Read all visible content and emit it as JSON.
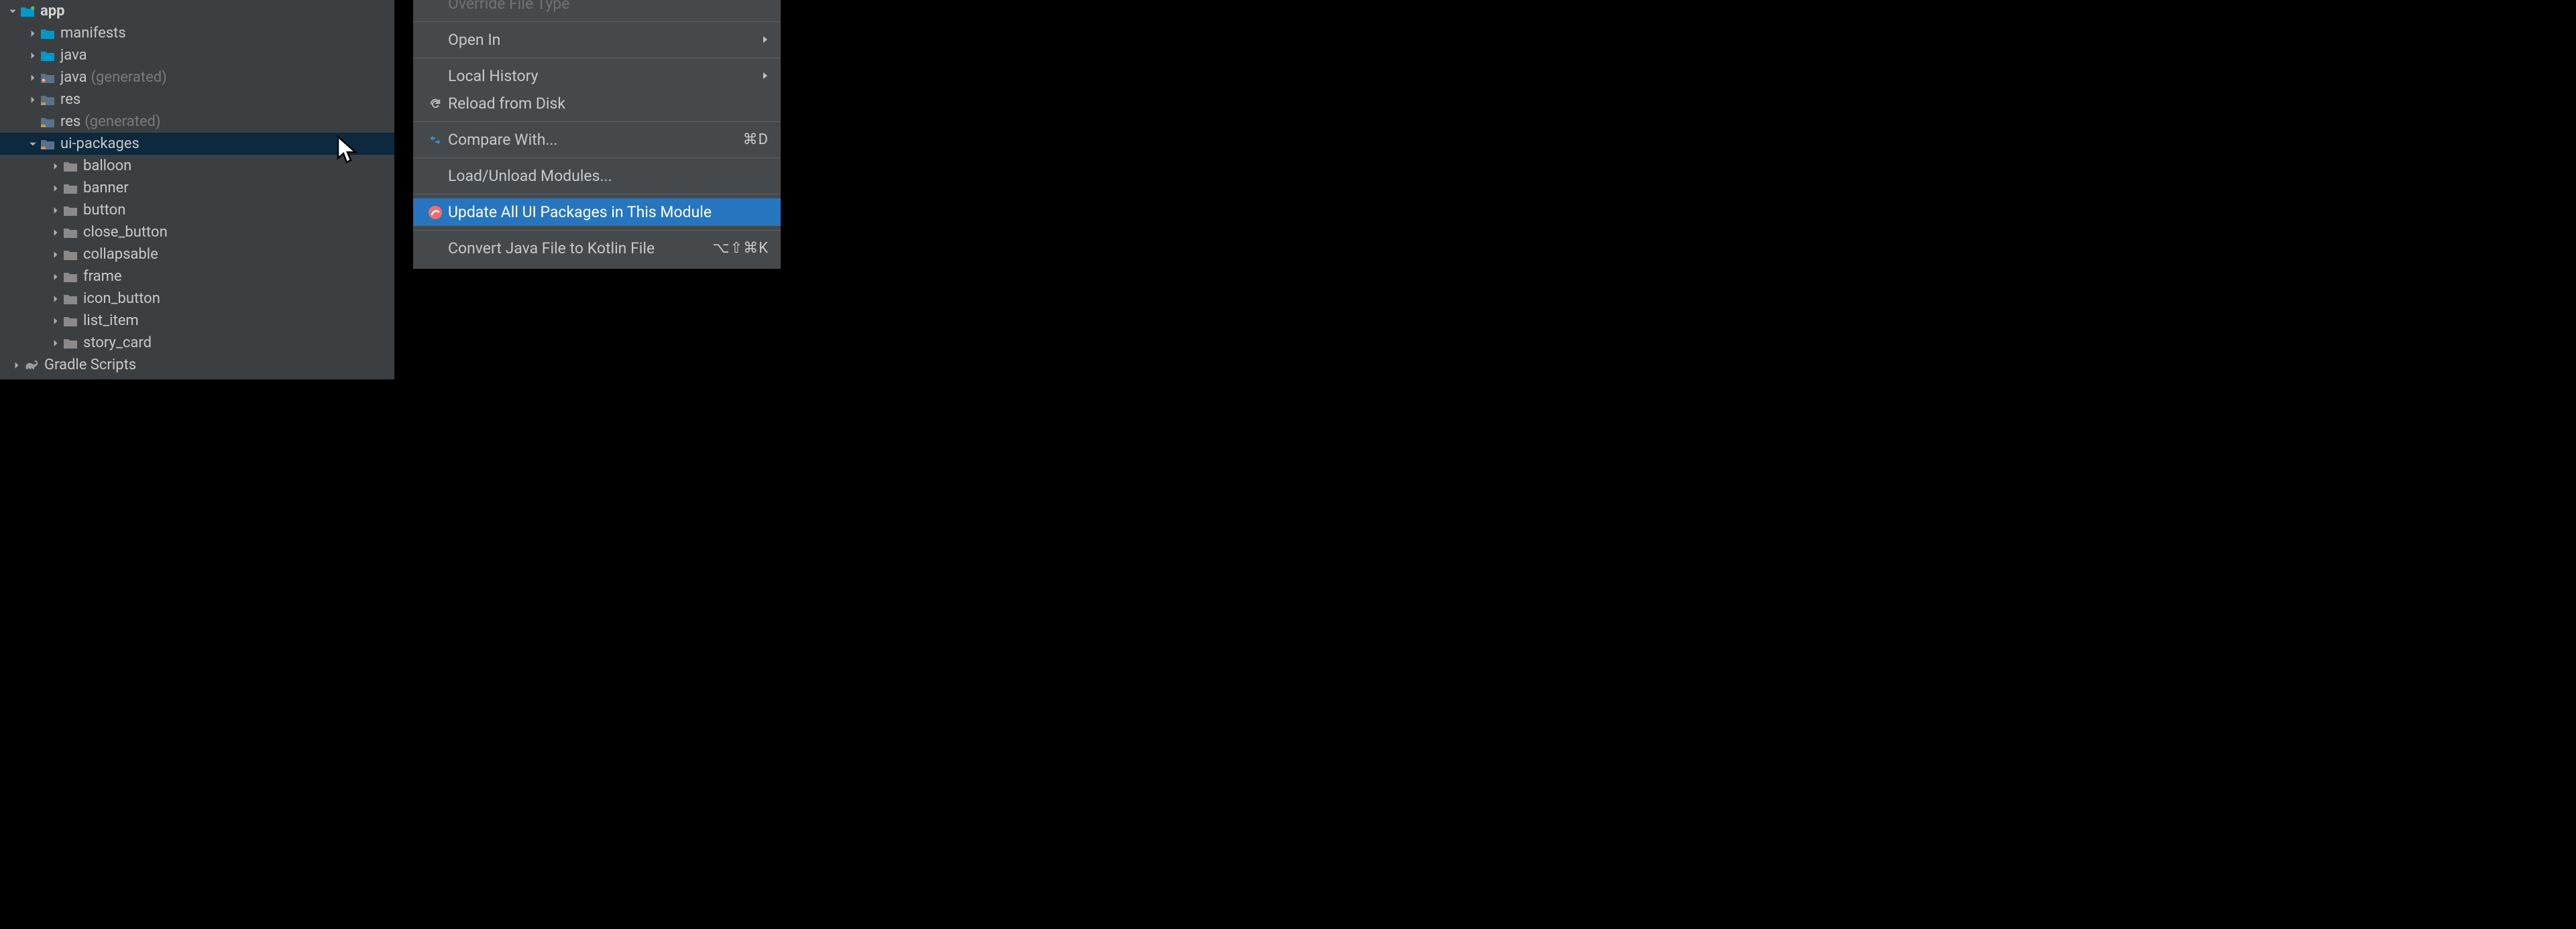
{
  "tree": {
    "app": "app",
    "items": [
      {
        "label": "manifests",
        "type": "folder-teal"
      },
      {
        "label": "java",
        "type": "folder-teal"
      },
      {
        "label": "java",
        "hint": "(generated)",
        "type": "folder-gen"
      },
      {
        "label": "res",
        "type": "folder-res"
      },
      {
        "label": "res",
        "hint": "(generated)",
        "type": "folder-res",
        "no_arrow": true
      },
      {
        "label": "ui-packages",
        "type": "folder-res",
        "expanded": true,
        "selected": true
      }
    ],
    "ui_packages": [
      "balloon",
      "banner",
      "button",
      "close_button",
      "collapsable",
      "frame",
      "icon_button",
      "list_item",
      "story_card"
    ],
    "gradle": "Gradle Scripts"
  },
  "menu": {
    "override": "Override File Type",
    "open_in": "Open In",
    "local_history": "Local History",
    "reload": "Reload from Disk",
    "compare": "Compare With...",
    "compare_shortcut": "⌘D",
    "load_unload": "Load/Unload Modules...",
    "update": "Update All UI Packages in This Module",
    "convert": "Convert Java File to Kotlin File",
    "convert_shortcut": "⌥⇧⌘K"
  }
}
